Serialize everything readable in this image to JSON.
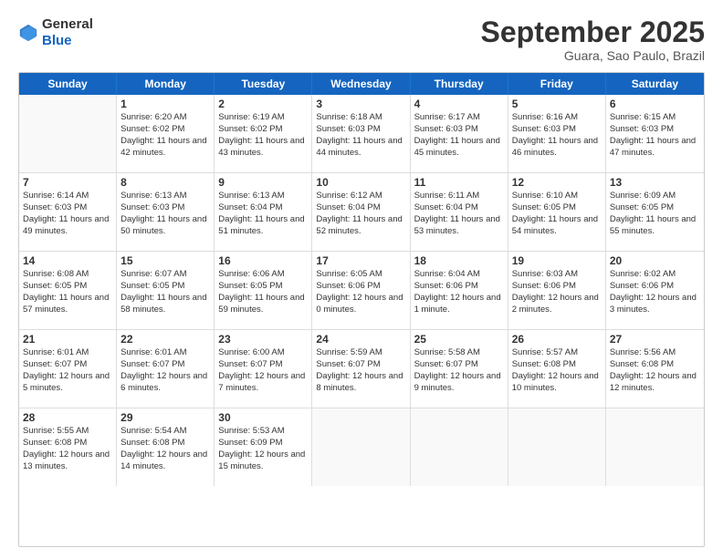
{
  "header": {
    "logo_general": "General",
    "logo_blue": "Blue",
    "month_title": "September 2025",
    "location": "Guara, Sao Paulo, Brazil"
  },
  "weekdays": [
    "Sunday",
    "Monday",
    "Tuesday",
    "Wednesday",
    "Thursday",
    "Friday",
    "Saturday"
  ],
  "weeks": [
    [
      {
        "day": "",
        "sunrise": "",
        "sunset": "",
        "daylight": ""
      },
      {
        "day": "1",
        "sunrise": "Sunrise: 6:20 AM",
        "sunset": "Sunset: 6:02 PM",
        "daylight": "Daylight: 11 hours and 42 minutes."
      },
      {
        "day": "2",
        "sunrise": "Sunrise: 6:19 AM",
        "sunset": "Sunset: 6:02 PM",
        "daylight": "Daylight: 11 hours and 43 minutes."
      },
      {
        "day": "3",
        "sunrise": "Sunrise: 6:18 AM",
        "sunset": "Sunset: 6:03 PM",
        "daylight": "Daylight: 11 hours and 44 minutes."
      },
      {
        "day": "4",
        "sunrise": "Sunrise: 6:17 AM",
        "sunset": "Sunset: 6:03 PM",
        "daylight": "Daylight: 11 hours and 45 minutes."
      },
      {
        "day": "5",
        "sunrise": "Sunrise: 6:16 AM",
        "sunset": "Sunset: 6:03 PM",
        "daylight": "Daylight: 11 hours and 46 minutes."
      },
      {
        "day": "6",
        "sunrise": "Sunrise: 6:15 AM",
        "sunset": "Sunset: 6:03 PM",
        "daylight": "Daylight: 11 hours and 47 minutes."
      }
    ],
    [
      {
        "day": "7",
        "sunrise": "Sunrise: 6:14 AM",
        "sunset": "Sunset: 6:03 PM",
        "daylight": "Daylight: 11 hours and 49 minutes."
      },
      {
        "day": "8",
        "sunrise": "Sunrise: 6:13 AM",
        "sunset": "Sunset: 6:03 PM",
        "daylight": "Daylight: 11 hours and 50 minutes."
      },
      {
        "day": "9",
        "sunrise": "Sunrise: 6:13 AM",
        "sunset": "Sunset: 6:04 PM",
        "daylight": "Daylight: 11 hours and 51 minutes."
      },
      {
        "day": "10",
        "sunrise": "Sunrise: 6:12 AM",
        "sunset": "Sunset: 6:04 PM",
        "daylight": "Daylight: 11 hours and 52 minutes."
      },
      {
        "day": "11",
        "sunrise": "Sunrise: 6:11 AM",
        "sunset": "Sunset: 6:04 PM",
        "daylight": "Daylight: 11 hours and 53 minutes."
      },
      {
        "day": "12",
        "sunrise": "Sunrise: 6:10 AM",
        "sunset": "Sunset: 6:05 PM",
        "daylight": "Daylight: 11 hours and 54 minutes."
      },
      {
        "day": "13",
        "sunrise": "Sunrise: 6:09 AM",
        "sunset": "Sunset: 6:05 PM",
        "daylight": "Daylight: 11 hours and 55 minutes."
      }
    ],
    [
      {
        "day": "14",
        "sunrise": "Sunrise: 6:08 AM",
        "sunset": "Sunset: 6:05 PM",
        "daylight": "Daylight: 11 hours and 57 minutes."
      },
      {
        "day": "15",
        "sunrise": "Sunrise: 6:07 AM",
        "sunset": "Sunset: 6:05 PM",
        "daylight": "Daylight: 11 hours and 58 minutes."
      },
      {
        "day": "16",
        "sunrise": "Sunrise: 6:06 AM",
        "sunset": "Sunset: 6:05 PM",
        "daylight": "Daylight: 11 hours and 59 minutes."
      },
      {
        "day": "17",
        "sunrise": "Sunrise: 6:05 AM",
        "sunset": "Sunset: 6:06 PM",
        "daylight": "Daylight: 12 hours and 0 minutes."
      },
      {
        "day": "18",
        "sunrise": "Sunrise: 6:04 AM",
        "sunset": "Sunset: 6:06 PM",
        "daylight": "Daylight: 12 hours and 1 minute."
      },
      {
        "day": "19",
        "sunrise": "Sunrise: 6:03 AM",
        "sunset": "Sunset: 6:06 PM",
        "daylight": "Daylight: 12 hours and 2 minutes."
      },
      {
        "day": "20",
        "sunrise": "Sunrise: 6:02 AM",
        "sunset": "Sunset: 6:06 PM",
        "daylight": "Daylight: 12 hours and 3 minutes."
      }
    ],
    [
      {
        "day": "21",
        "sunrise": "Sunrise: 6:01 AM",
        "sunset": "Sunset: 6:07 PM",
        "daylight": "Daylight: 12 hours and 5 minutes."
      },
      {
        "day": "22",
        "sunrise": "Sunrise: 6:01 AM",
        "sunset": "Sunset: 6:07 PM",
        "daylight": "Daylight: 12 hours and 6 minutes."
      },
      {
        "day": "23",
        "sunrise": "Sunrise: 6:00 AM",
        "sunset": "Sunset: 6:07 PM",
        "daylight": "Daylight: 12 hours and 7 minutes."
      },
      {
        "day": "24",
        "sunrise": "Sunrise: 5:59 AM",
        "sunset": "Sunset: 6:07 PM",
        "daylight": "Daylight: 12 hours and 8 minutes."
      },
      {
        "day": "25",
        "sunrise": "Sunrise: 5:58 AM",
        "sunset": "Sunset: 6:07 PM",
        "daylight": "Daylight: 12 hours and 9 minutes."
      },
      {
        "day": "26",
        "sunrise": "Sunrise: 5:57 AM",
        "sunset": "Sunset: 6:08 PM",
        "daylight": "Daylight: 12 hours and 10 minutes."
      },
      {
        "day": "27",
        "sunrise": "Sunrise: 5:56 AM",
        "sunset": "Sunset: 6:08 PM",
        "daylight": "Daylight: 12 hours and 12 minutes."
      }
    ],
    [
      {
        "day": "28",
        "sunrise": "Sunrise: 5:55 AM",
        "sunset": "Sunset: 6:08 PM",
        "daylight": "Daylight: 12 hours and 13 minutes."
      },
      {
        "day": "29",
        "sunrise": "Sunrise: 5:54 AM",
        "sunset": "Sunset: 6:08 PM",
        "daylight": "Daylight: 12 hours and 14 minutes."
      },
      {
        "day": "30",
        "sunrise": "Sunrise: 5:53 AM",
        "sunset": "Sunset: 6:09 PM",
        "daylight": "Daylight: 12 hours and 15 minutes."
      },
      {
        "day": "",
        "sunrise": "",
        "sunset": "",
        "daylight": ""
      },
      {
        "day": "",
        "sunrise": "",
        "sunset": "",
        "daylight": ""
      },
      {
        "day": "",
        "sunrise": "",
        "sunset": "",
        "daylight": ""
      },
      {
        "day": "",
        "sunrise": "",
        "sunset": "",
        "daylight": ""
      }
    ]
  ]
}
